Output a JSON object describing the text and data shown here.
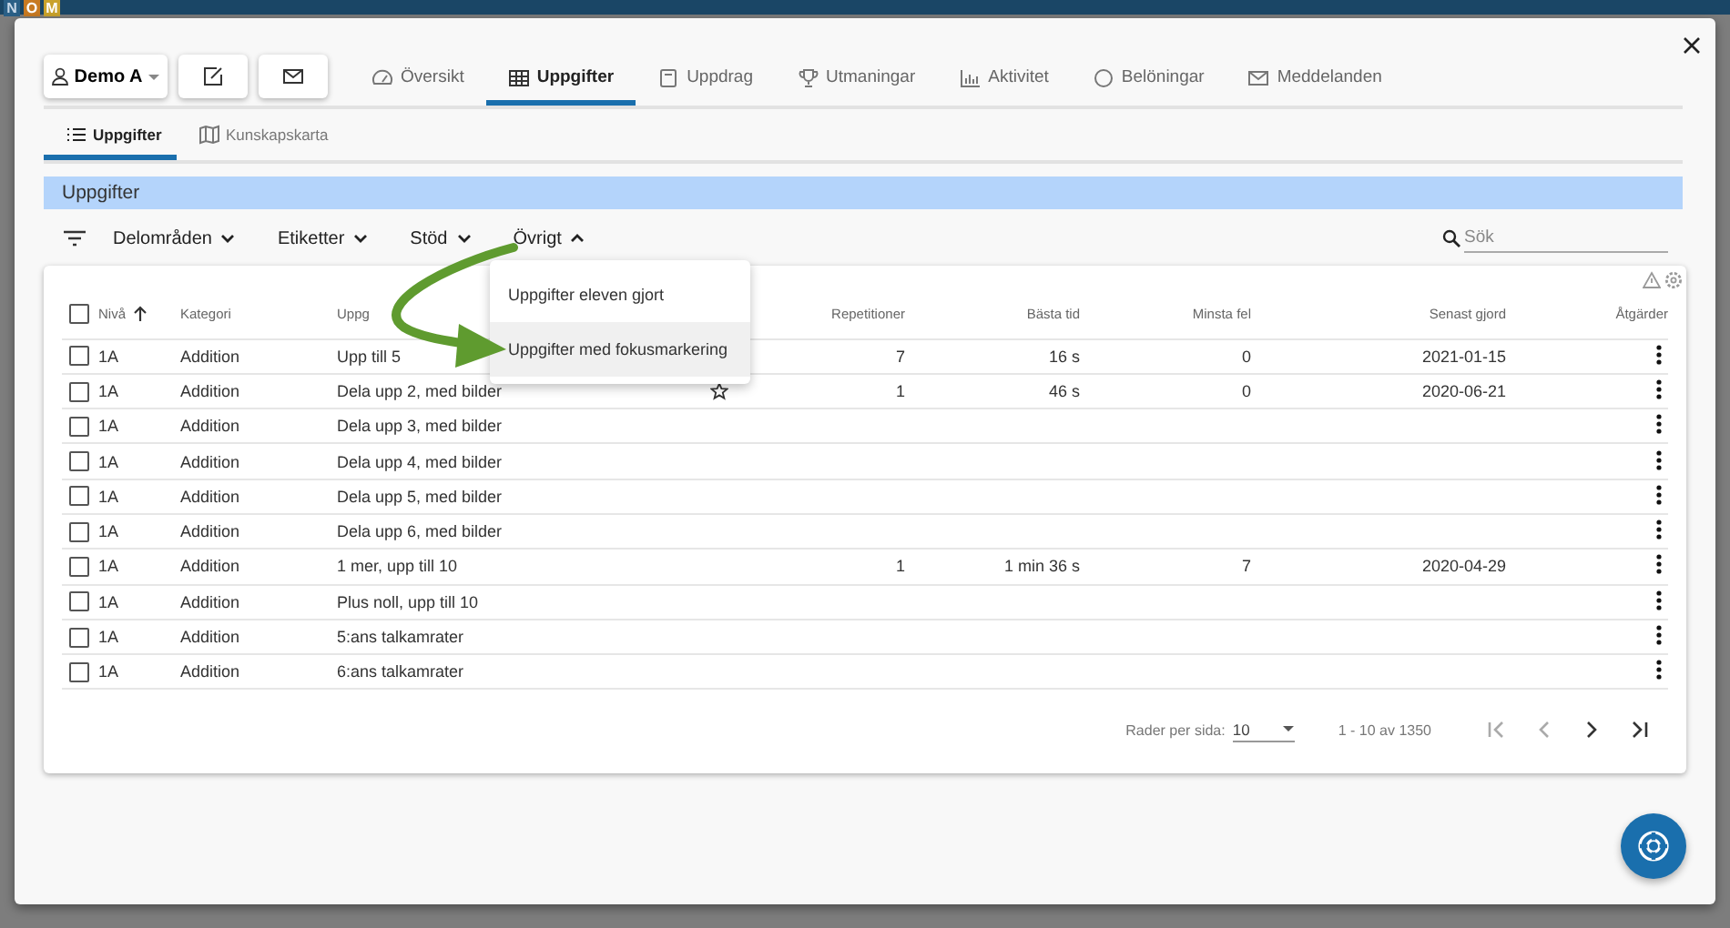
{
  "backdrop": {
    "logo_letters": [
      "N",
      "O",
      "M"
    ]
  },
  "toolbar": {
    "user_button": "Demo A",
    "tabs": [
      {
        "label": "Översikt",
        "selected": false
      },
      {
        "label": "Uppgifter",
        "selected": true
      },
      {
        "label": "Uppdrag",
        "selected": false
      },
      {
        "label": "Utmaningar",
        "selected": false
      },
      {
        "label": "Aktivitet",
        "selected": false
      },
      {
        "label": "Belöningar",
        "selected": false
      },
      {
        "label": "Meddelanden",
        "selected": false
      }
    ]
  },
  "subtabs": [
    {
      "label": "Uppgifter",
      "selected": true
    },
    {
      "label": "Kunskapskarta",
      "selected": false
    }
  ],
  "section_title": "Uppgifter",
  "filters": [
    {
      "label": "Delområden",
      "expanded": false
    },
    {
      "label": "Etiketter",
      "expanded": false
    },
    {
      "label": "Stöd",
      "expanded": false
    },
    {
      "label": "Övrigt",
      "expanded": true
    }
  ],
  "search": {
    "placeholder": "Sök"
  },
  "dropdown_menu": [
    {
      "label": "Uppgifter eleven gjort",
      "highlighted": false
    },
    {
      "label": "Uppgifter med fokusmarkering",
      "highlighted": true
    }
  ],
  "table": {
    "all_checked": false,
    "columns": [
      {
        "label": "Nivå",
        "sorted": true
      },
      {
        "label": "Kategori",
        "sorted": false
      },
      {
        "label": "Uppg",
        "sorted": false
      },
      {
        "label": "Repetitioner",
        "sorted": false
      },
      {
        "label": "Bästa tid",
        "sorted": false
      },
      {
        "label": "Minsta fel",
        "sorted": false
      },
      {
        "label": "Senast gjord",
        "sorted": false
      },
      {
        "label": "Åtgärder",
        "sorted": false
      }
    ],
    "rows": [
      {
        "checked": false,
        "level": "1A",
        "category": "Addition",
        "task": "Upp till 5",
        "starred": false,
        "repetitions": "7",
        "best_time": "16 s",
        "fewest_errors": "0",
        "last_done": "2021-01-15"
      },
      {
        "checked": false,
        "level": "1A",
        "category": "Addition",
        "task": "Dela upp 2, med bilder",
        "starred": true,
        "repetitions": "1",
        "best_time": "46 s",
        "fewest_errors": "0",
        "last_done": "2020-06-21"
      },
      {
        "checked": false,
        "level": "1A",
        "category": "Addition",
        "task": "Dela upp 3, med bilder",
        "starred": false
      },
      {
        "checked": false,
        "level": "1A",
        "category": "Addition",
        "task": "Dela upp 4, med bilder",
        "starred": false
      },
      {
        "checked": false,
        "level": "1A",
        "category": "Addition",
        "task": "Dela upp 5, med bilder",
        "starred": false
      },
      {
        "checked": false,
        "level": "1A",
        "category": "Addition",
        "task": "Dela upp 6, med bilder",
        "starred": false
      },
      {
        "checked": false,
        "level": "1A",
        "category": "Addition",
        "task": "1 mer, upp till 10",
        "starred": false,
        "repetitions": "1",
        "best_time": "1 min 36 s",
        "fewest_errors": "7",
        "last_done": "2020-04-29"
      },
      {
        "checked": false,
        "level": "1A",
        "category": "Addition",
        "task": "Plus noll, upp till 10",
        "starred": false
      },
      {
        "checked": false,
        "level": "1A",
        "category": "Addition",
        "task": "5:ans talkamrater",
        "starred": false
      },
      {
        "checked": false,
        "level": "1A",
        "category": "Addition",
        "task": "6:ans talkamrater",
        "starred": false
      }
    ]
  },
  "pagination": {
    "rows_per_page_label": "Rader per sida:",
    "rows_per_page": "10",
    "range": "1 - 10 av 1350",
    "first_disabled": true,
    "previous_disabled": true,
    "next_disabled": false,
    "last_disabled": false
  }
}
